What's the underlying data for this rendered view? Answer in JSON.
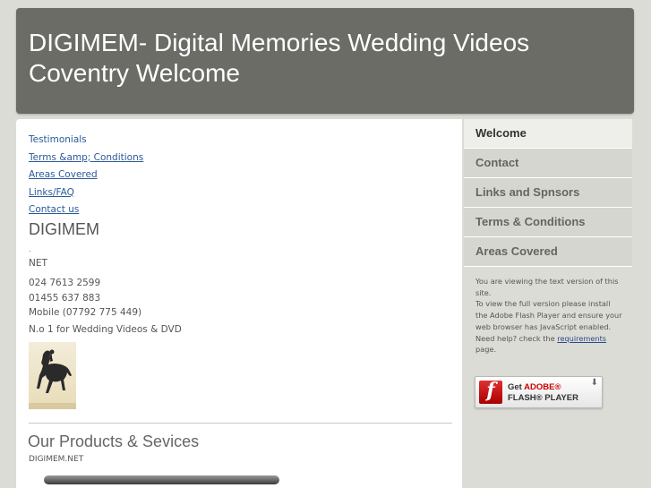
{
  "header": {
    "title": "DIGIMEM- Digital Memories Wedding Videos Coventry Welcome"
  },
  "main": {
    "links": [
      {
        "label": "Testimonials"
      },
      {
        "label": "Terms &amp; Conditions"
      },
      {
        "label": "Areas Covered"
      },
      {
        "label": "Links/FAQ"
      },
      {
        "label": "Contact us"
      }
    ],
    "brand": "DIGIMEM",
    "dot": ".",
    "net": "NET",
    "phones": [
      "024 7613 2599",
      "01455 637 883",
      "Mobile (07792 775 449)"
    ],
    "tagline": "N.o 1 for Wedding Videos & DVD",
    "products_heading": "Our Products & Sevices",
    "products_sub": "DIGIMEM.NET"
  },
  "sidebar": {
    "nav": [
      {
        "label": "Welcome",
        "active": true
      },
      {
        "label": "Contact"
      },
      {
        "label": "Links and Spnsors"
      },
      {
        "label": "Terms & Conditions"
      },
      {
        "label": "Areas Covered"
      }
    ],
    "flash_note": {
      "line1": "You are viewing the text version of this site.",
      "line2": "To view the full version please install the Adobe Flash Player and ensure your web browser has JavaScript enabled.",
      "line3_pre": "Need help? check the ",
      "line3_link": "requirements",
      "line3_post": " page."
    },
    "flash_badge": {
      "get": "Get",
      "adobe": "ADOBE®",
      "product": "FLASH® PLAYER",
      "logo_letter": "f"
    }
  },
  "colors": {
    "header_bg": "#6b6c66",
    "page_bg": "#dcdcd6",
    "link": "#2a5a9a",
    "nav_bg": "#d6d6d0",
    "nav_active_bg": "#eeeeea"
  }
}
